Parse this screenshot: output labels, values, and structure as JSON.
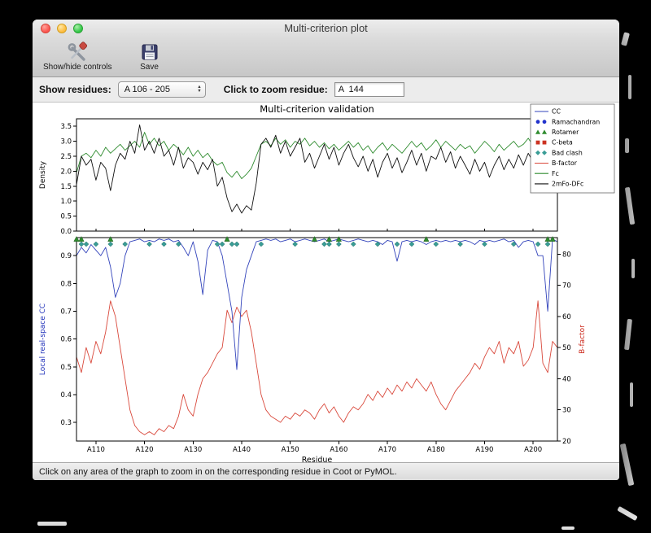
{
  "window": {
    "title": "Multi-criterion plot",
    "toolbar": {
      "show_hide_label": "Show/hide controls",
      "save_label": "Save"
    },
    "controls": {
      "show_residues_label": "Show residues:",
      "residue_range_value": "A 106 - 205",
      "zoom_label": "Click to zoom residue:",
      "zoom_value": "A  144"
    },
    "status_text": "Click on any area of the graph to zoom in on the corresponding residue in Coot or PyMOL."
  },
  "chart_data": {
    "type": "line",
    "title": "Multi-criterion validation",
    "xlabel": "Residue",
    "x_start": 106,
    "x_end": 205,
    "x_tick_values": [
      110,
      120,
      130,
      140,
      150,
      160,
      170,
      180,
      190,
      200
    ],
    "x_tick_labels": [
      "A110",
      "A120",
      "A130",
      "A140",
      "A150",
      "A160",
      "A170",
      "A180",
      "A190",
      "A200"
    ],
    "top": {
      "ylabel": "Density",
      "ylim": [
        0,
        3.75
      ],
      "yticks": [
        0.0,
        0.5,
        1.0,
        1.5,
        2.0,
        2.5,
        3.0,
        3.5
      ],
      "series": [
        {
          "name": "Fc",
          "color": "#2e8b2e",
          "values": [
            1.95,
            2.5,
            2.6,
            2.45,
            2.7,
            2.5,
            2.8,
            2.6,
            2.75,
            2.9,
            2.7,
            2.85,
            3.0,
            2.8,
            3.3,
            2.9,
            3.1,
            2.85,
            3.0,
            2.7,
            2.9,
            2.75,
            2.55,
            2.8,
            2.5,
            2.7,
            2.45,
            2.6,
            2.35,
            2.2,
            2.3,
            1.95,
            1.8,
            2.0,
            1.75,
            1.9,
            2.1,
            2.5,
            2.9,
            3.0,
            2.85,
            3.1,
            2.9,
            3.05,
            2.8,
            3.0,
            2.9,
            3.1,
            2.85,
            3.0,
            2.8,
            2.95,
            2.75,
            2.9,
            2.7,
            2.85,
            3.0,
            2.8,
            2.95,
            2.7,
            2.85,
            2.6,
            2.8,
            2.95,
            2.7,
            2.9,
            2.75,
            2.6,
            2.8,
            3.0,
            2.8,
            2.95,
            2.7,
            2.85,
            3.05,
            2.8,
            3.0,
            2.85,
            2.7,
            2.9,
            2.75,
            2.85,
            2.6,
            2.8,
            3.0,
            2.85,
            2.65,
            2.9,
            2.7,
            2.85,
            3.0,
            2.8,
            2.9,
            3.1,
            2.85,
            2.6,
            2.9,
            3.0,
            2.75,
            2.9
          ]
        },
        {
          "name": "2mFo-DFc",
          "color": "#111111",
          "values": [
            1.55,
            2.5,
            2.2,
            2.4,
            1.7,
            2.3,
            2.1,
            1.35,
            2.2,
            2.6,
            2.4,
            3.0,
            2.6,
            3.55,
            2.7,
            3.0,
            2.6,
            3.1,
            2.5,
            2.7,
            2.2,
            2.8,
            2.1,
            2.45,
            2.3,
            1.9,
            2.3,
            2.05,
            2.4,
            1.5,
            1.8,
            1.1,
            0.65,
            0.9,
            0.6,
            0.85,
            0.7,
            1.6,
            2.9,
            3.1,
            2.8,
            3.2,
            2.6,
            3.0,
            2.5,
            2.8,
            3.1,
            2.3,
            2.6,
            2.1,
            2.5,
            2.9,
            2.4,
            2.8,
            2.2,
            2.6,
            2.9,
            2.45,
            2.15,
            2.5,
            2.0,
            2.4,
            1.8,
            2.3,
            2.6,
            2.1,
            2.45,
            1.95,
            2.3,
            2.7,
            2.2,
            2.6,
            2.0,
            2.5,
            2.4,
            2.8,
            2.3,
            2.65,
            2.1,
            2.5,
            2.2,
            1.9,
            2.4,
            2.0,
            2.3,
            1.8,
            2.2,
            2.5,
            2.05,
            2.4,
            2.1,
            2.55,
            2.2,
            2.6,
            2.3,
            2.0,
            2.4,
            1.6,
            2.5,
            2.6
          ]
        }
      ]
    },
    "bottom": {
      "ylabel_left": "Local real-space CC",
      "ylabel_left_color": "#2233bb",
      "ylabel_right": "B-factor",
      "ylabel_right_color": "#cc2a1d",
      "ylim_left": [
        0.233,
        0.965
      ],
      "ylim_right": [
        20,
        85.3
      ],
      "yticks_left": [
        0.3,
        0.4,
        0.5,
        0.6,
        0.7,
        0.8,
        0.9
      ],
      "yticks_right": [
        20,
        30,
        40,
        50,
        60,
        70,
        80
      ],
      "series_left": {
        "name": "CC",
        "color": "#3344bb",
        "values": [
          0.9,
          0.93,
          0.91,
          0.94,
          0.92,
          0.9,
          0.93,
          0.86,
          0.75,
          0.8,
          0.9,
          0.95,
          0.955,
          0.96,
          0.95,
          0.955,
          0.95,
          0.96,
          0.955,
          0.96,
          0.95,
          0.955,
          0.93,
          0.9,
          0.95,
          0.88,
          0.76,
          0.92,
          0.955,
          0.95,
          0.9,
          0.8,
          0.7,
          0.49,
          0.75,
          0.85,
          0.9,
          0.95,
          0.955,
          0.96,
          0.955,
          0.96,
          0.95,
          0.955,
          0.96,
          0.95,
          0.955,
          0.96,
          0.955,
          0.95,
          0.955,
          0.96,
          0.95,
          0.955,
          0.96,
          0.955,
          0.95,
          0.955,
          0.96,
          0.955,
          0.95,
          0.955,
          0.95,
          0.94,
          0.955,
          0.95,
          0.88,
          0.95,
          0.955,
          0.95,
          0.955,
          0.95,
          0.94,
          0.95,
          0.955,
          0.95,
          0.955,
          0.95,
          0.955,
          0.95,
          0.955,
          0.95,
          0.94,
          0.955,
          0.95,
          0.955,
          0.95,
          0.955,
          0.96,
          0.95,
          0.955,
          0.93,
          0.95,
          0.955,
          0.95,
          0.9,
          0.9,
          0.7,
          0.96,
          0.95
        ]
      },
      "series_right": {
        "name": "B-factor",
        "color": "#d9493c",
        "values": [
          47,
          42,
          50,
          45,
          52,
          48,
          55,
          65,
          60,
          50,
          40,
          30,
          25,
          23,
          22,
          23,
          22,
          24,
          23,
          25,
          24,
          28,
          35,
          30,
          28,
          35,
          40,
          42,
          45,
          48,
          50,
          62,
          58,
          63,
          60,
          62,
          55,
          45,
          35,
          30,
          28,
          27,
          26,
          28,
          27,
          29,
          28,
          30,
          29,
          27,
          30,
          32,
          29,
          31,
          28,
          26,
          29,
          31,
          30,
          32,
          35,
          33,
          36,
          34,
          37,
          35,
          38,
          36,
          39,
          37,
          40,
          38,
          36,
          39,
          35,
          32,
          30,
          33,
          36,
          38,
          40,
          42,
          45,
          43,
          47,
          50,
          48,
          52,
          45,
          50,
          48,
          52,
          44,
          46,
          50,
          65,
          45,
          42,
          52,
          50
        ]
      }
    },
    "markers": {
      "bad_clash": {
        "color": "#3a9d96",
        "residues": [
          107,
          108,
          110,
          113,
          116,
          121,
          124,
          127,
          135,
          136,
          138,
          139,
          144,
          151,
          157,
          158,
          160,
          163,
          168,
          172,
          175,
          180,
          185,
          190,
          196,
          201,
          203
        ]
      },
      "rotamer": {
        "color": "#2e8b2e",
        "residues": [
          106,
          107,
          113,
          137,
          155,
          158,
          160,
          178,
          203,
          204
        ]
      }
    },
    "legend": [
      {
        "label": "CC",
        "type": "line",
        "color": "#3344bb"
      },
      {
        "label": "Ramachandran",
        "type": "circles",
        "color": "#2233cc"
      },
      {
        "label": "Rotamer",
        "type": "triangles",
        "color": "#2e8b2e"
      },
      {
        "label": "C-beta",
        "type": "squares",
        "color": "#cc3322"
      },
      {
        "label": "Bad clash",
        "type": "diamonds",
        "color": "#3a9d96"
      },
      {
        "label": "B-factor",
        "type": "line",
        "color": "#d9493c"
      },
      {
        "label": "Fc",
        "type": "line",
        "color": "#2e8b2e"
      },
      {
        "label": "2mFo-DFc",
        "type": "line",
        "color": "#111111"
      }
    ]
  }
}
